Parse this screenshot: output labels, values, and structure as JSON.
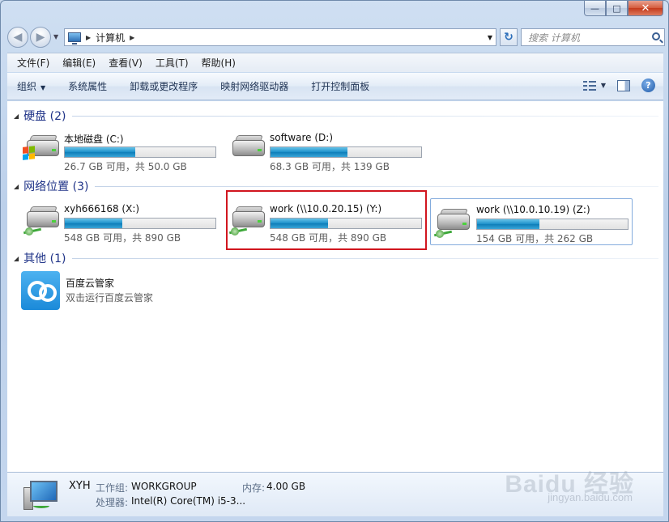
{
  "caption": {
    "minimize": "—",
    "maximize": "□",
    "close": "✕"
  },
  "address": {
    "crumbs": [
      "计算机"
    ],
    "search_placeholder": "搜索 计算机"
  },
  "menu": [
    "文件(F)",
    "编辑(E)",
    "查看(V)",
    "工具(T)",
    "帮助(H)"
  ],
  "commands": [
    "组织",
    "系统属性",
    "卸载或更改程序",
    "映射网络驱动器",
    "打开控制面板"
  ],
  "groups": [
    {
      "title": "硬盘 (2)",
      "items": [
        {
          "name": "本地磁盘 (C:)",
          "info": "26.7 GB 可用，共 50.0 GB",
          "used_fraction": 0.466,
          "icon": "windows-drive-icon"
        },
        {
          "name": "software (D:)",
          "info": "68.3 GB 可用，共 139 GB",
          "used_fraction": 0.509,
          "icon": "hard-drive-icon"
        }
      ]
    },
    {
      "title": "网络位置 (3)",
      "items": [
        {
          "name": "xyh666168 (X:)",
          "info": "548 GB 可用，共 890 GB",
          "used_fraction": 0.384,
          "icon": "network-drive-icon"
        },
        {
          "name": "work (\\\\10.0.20.15) (Y:)",
          "info": "548 GB 可用，共 890 GB",
          "used_fraction": 0.384,
          "icon": "network-drive-icon"
        },
        {
          "name": "work (\\\\10.0.10.19) (Z:)",
          "info": "154 GB 可用，共 262 GB",
          "used_fraction": 0.412,
          "icon": "network-drive-icon"
        }
      ]
    },
    {
      "title": "其他 (1)",
      "items": [
        {
          "name": "百度云管家",
          "info": "双击运行百度云管家",
          "icon": "baidu-cloud-icon"
        }
      ]
    }
  ],
  "details": {
    "computer_name": "XYH",
    "workgroup_label": "工作组:",
    "workgroup_value": "WORKGROUP",
    "memory_label": "内存:",
    "memory_value": "4.00 GB",
    "cpu_label": "处理器:",
    "cpu_value": "Intel(R) Core(TM) i5-3..."
  },
  "watermark": {
    "main": "Baidu 经验",
    "sub": "jingyan.baidu.com"
  },
  "colors": {
    "highlight": "#d1161f",
    "group_title": "#1e3287",
    "drive_fill": "#1b8fc9"
  }
}
